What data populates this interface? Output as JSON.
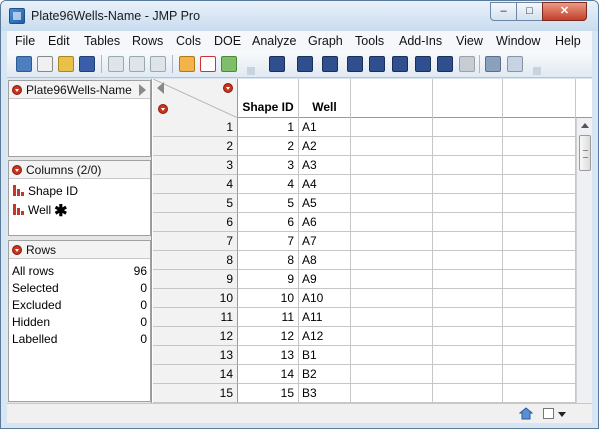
{
  "window": {
    "title": "Plate96Wells-Name - JMP Pro",
    "minimize_glyph": "–",
    "maximize_glyph": "□",
    "close_glyph": "✕"
  },
  "menu": [
    {
      "label": "File"
    },
    {
      "label": "Edit"
    },
    {
      "label": "Tables"
    },
    {
      "label": "Rows"
    },
    {
      "label": "Cols"
    },
    {
      "label": "DOE"
    },
    {
      "label": "Analyze"
    },
    {
      "label": "Graph"
    },
    {
      "label": "Tools"
    },
    {
      "label": "Add-Ins"
    },
    {
      "label": "View"
    },
    {
      "label": "Window"
    },
    {
      "label": "Help"
    }
  ],
  "toolbar_icons": [
    "new-table-icon",
    "new-script-icon",
    "open-icon",
    "save-icon",
    "cut-icon",
    "copy-icon",
    "paste-icon",
    "data-table-icon",
    "journal-icon",
    "run-icon",
    "distribution-icon",
    "fit-y-by-x-icon",
    "fit-model-icon",
    "multivariate-icon",
    "control-chart-icon",
    "graph-builder-icon",
    "variability-icon",
    "tabulate-icon",
    "partition-icon",
    "layout-icon",
    "preferences-icon"
  ],
  "table_panel": {
    "name": "Plate96Wells-Name"
  },
  "columns_panel": {
    "title": "Columns (2/0)",
    "items": [
      {
        "name": "Shape ID",
        "marker": ""
      },
      {
        "name": "Well",
        "marker": "✱"
      }
    ]
  },
  "rows_panel": {
    "title": "Rows",
    "stats": [
      {
        "label": "All rows",
        "value": "96"
      },
      {
        "label": "Selected",
        "value": "0"
      },
      {
        "label": "Excluded",
        "value": "0"
      },
      {
        "label": "Hidden",
        "value": "0"
      },
      {
        "label": "Labelled",
        "value": "0"
      }
    ]
  },
  "grid": {
    "columns": [
      "Shape ID",
      "Well",
      "",
      "",
      ""
    ],
    "rows": [
      {
        "n": "1",
        "shape_id": "1",
        "well": "A1"
      },
      {
        "n": "2",
        "shape_id": "2",
        "well": "A2"
      },
      {
        "n": "3",
        "shape_id": "3",
        "well": "A3"
      },
      {
        "n": "4",
        "shape_id": "4",
        "well": "A4"
      },
      {
        "n": "5",
        "shape_id": "5",
        "well": "A5"
      },
      {
        "n": "6",
        "shape_id": "6",
        "well": "A6"
      },
      {
        "n": "7",
        "shape_id": "7",
        "well": "A7"
      },
      {
        "n": "8",
        "shape_id": "8",
        "well": "A8"
      },
      {
        "n": "9",
        "shape_id": "9",
        "well": "A9"
      },
      {
        "n": "10",
        "shape_id": "10",
        "well": "A10"
      },
      {
        "n": "11",
        "shape_id": "11",
        "well": "A11"
      },
      {
        "n": "12",
        "shape_id": "12",
        "well": "A12"
      },
      {
        "n": "13",
        "shape_id": "13",
        "well": "B1"
      },
      {
        "n": "14",
        "shape_id": "14",
        "well": "B2"
      },
      {
        "n": "15",
        "shape_id": "15",
        "well": "B3"
      }
    ]
  },
  "colors": {
    "disclosure_red": "#c8341d",
    "column_icon_red": "#c0392b",
    "row_header_bg": "#f2f2f2",
    "frame_blue": "#d8e6f4"
  }
}
